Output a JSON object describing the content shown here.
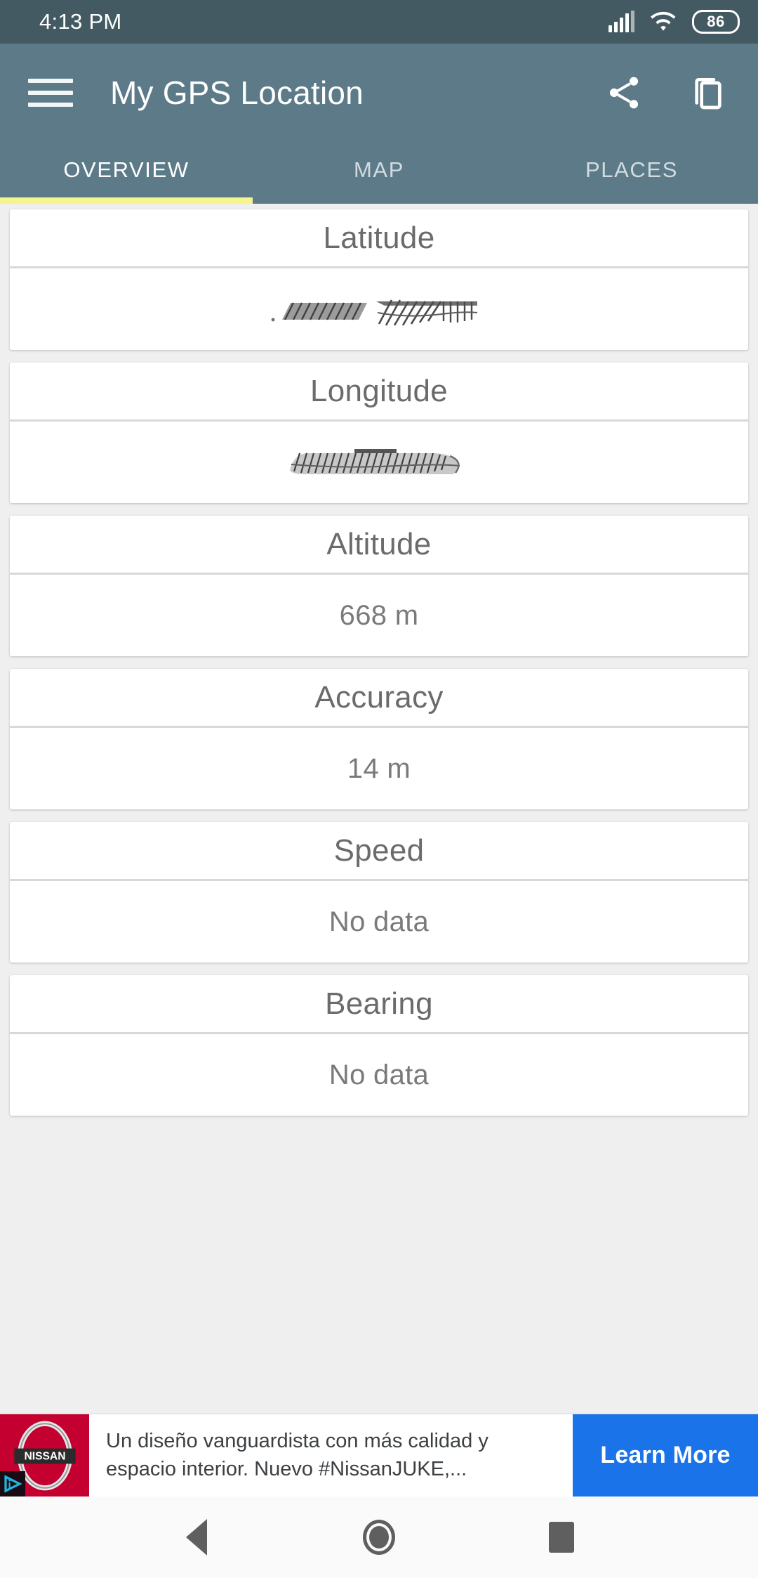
{
  "status_bar": {
    "time": "4:13 PM",
    "battery_level": "86",
    "icons": [
      "signal-icon",
      "wifi-icon",
      "battery-icon"
    ]
  },
  "app_bar": {
    "title": "My GPS Location",
    "menu_icon": "hamburger-menu-icon",
    "share_icon": "share-icon",
    "copy_icon": "copy-icon"
  },
  "tabs": {
    "items": [
      {
        "label": "OVERVIEW",
        "active": true
      },
      {
        "label": "MAP",
        "active": false
      },
      {
        "label": "PLACES",
        "active": false
      }
    ],
    "indicator_color": "#F4F58C"
  },
  "cards": [
    {
      "title": "Latitude",
      "value": "",
      "redacted": true
    },
    {
      "title": "Longitude",
      "value": "",
      "redacted": true
    },
    {
      "title": "Altitude",
      "value": "668 m",
      "redacted": false
    },
    {
      "title": "Accuracy",
      "value": "14 m",
      "redacted": false
    },
    {
      "title": "Speed",
      "value": "No data",
      "redacted": false
    },
    {
      "title": "Bearing",
      "value": "No data",
      "redacted": false
    }
  ],
  "ad": {
    "brand": "NISSAN",
    "body": "Un diseño vanguardista con más calidad y espacio interior. Nuevo #NissanJUKE,...",
    "cta_label": "Learn More",
    "adchoices_icon": "adchoices-icon",
    "brand_bg": "#C3002F",
    "cta_bg": "#1A73E8"
  },
  "nav_bar": {
    "back_label": "Back",
    "home_label": "Home",
    "recents_label": "Recents"
  },
  "colors": {
    "status_bar": "#445A63",
    "app_bar": "#5C7A88",
    "content_bg": "#EFEFEF",
    "card_bg": "#FFFFFF",
    "accent": "#F4F58C"
  }
}
